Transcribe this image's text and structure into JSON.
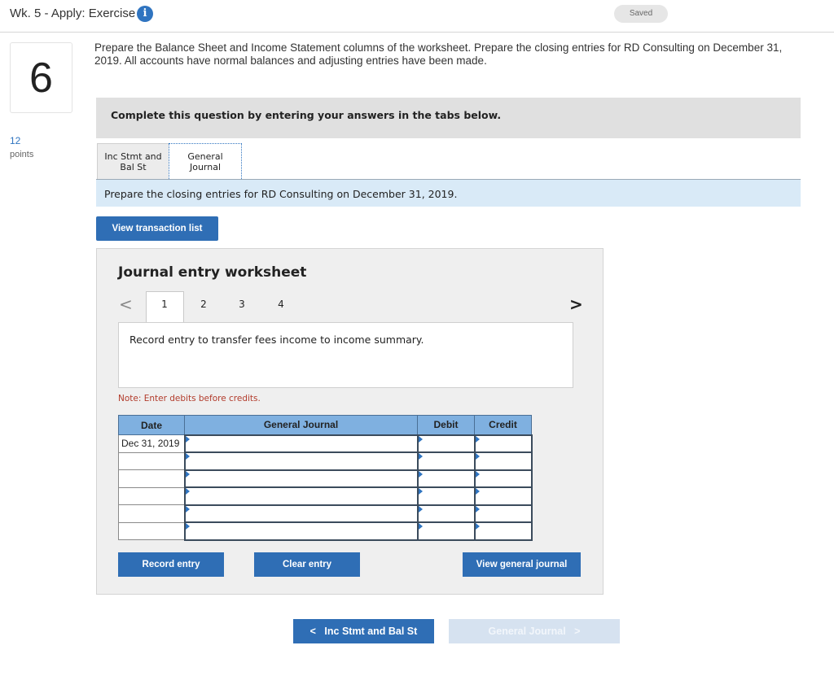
{
  "header": {
    "title": "Wk. 5 - Apply: Exercise",
    "info_icon": "i",
    "saved_label": "Saved"
  },
  "question": {
    "number": "6",
    "points_value": "12",
    "points_label": "points",
    "prompt": "Prepare the Balance Sheet and Income Statement columns of the worksheet. Prepare the closing entries for RD Consulting on December 31, 2019. All accounts have normal balances and adjusting entries have been made."
  },
  "instructions": "Complete this question by entering your answers in the tabs below.",
  "tabs": [
    {
      "line1": "Inc Stmt and",
      "line2": "Bal St",
      "active": false
    },
    {
      "line1": "General",
      "line2": "Journal",
      "active": true
    }
  ],
  "subtitle": "Prepare the closing entries for RD Consulting on December 31, 2019.",
  "view_transaction_list_label": "View transaction list",
  "worksheet": {
    "title": "Journal entry worksheet",
    "prev_arrow": "<",
    "next_arrow": ">",
    "steps": [
      "1",
      "2",
      "3",
      "4"
    ],
    "active_step": "1",
    "description": "Record entry to transfer fees income to income summary.",
    "note": "Note: Enter debits before credits.",
    "table": {
      "headers": [
        "Date",
        "General Journal",
        "Debit",
        "Credit"
      ],
      "rows": [
        {
          "date": "Dec 31, 2019",
          "account": "",
          "debit": "",
          "credit": ""
        },
        {
          "date": "",
          "account": "",
          "debit": "",
          "credit": ""
        },
        {
          "date": "",
          "account": "",
          "debit": "",
          "credit": ""
        },
        {
          "date": "",
          "account": "",
          "debit": "",
          "credit": ""
        },
        {
          "date": "",
          "account": "",
          "debit": "",
          "credit": ""
        },
        {
          "date": "",
          "account": "",
          "debit": "",
          "credit": ""
        }
      ]
    },
    "buttons": {
      "record": "Record entry",
      "clear": "Clear entry",
      "view_general_journal": "View general journal"
    }
  },
  "bottom_nav": {
    "prev_arrow": "<",
    "prev_label": "Inc Stmt and Bal St",
    "next_label": "General Journal",
    "next_arrow": ">"
  },
  "colors": {
    "primary_button": "#2f6eb5",
    "table_header": "#7fb0e0",
    "subtitle_band": "#d9eaf7",
    "note_text": "#b23b2b"
  }
}
